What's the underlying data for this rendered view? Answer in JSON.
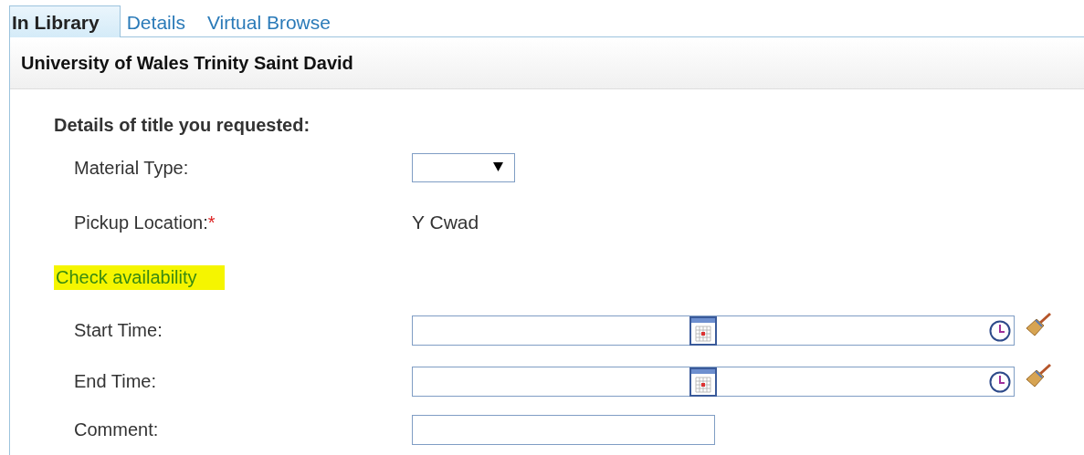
{
  "tabs": [
    {
      "label": "In Library",
      "selected": true
    },
    {
      "label": "Details",
      "selected": false
    },
    {
      "label": "Virtual Browse",
      "selected": false
    }
  ],
  "panel": {
    "title": "University of Wales Trinity Saint David",
    "section_heading": "Details of title you requested:",
    "fields": [
      {
        "kind": "select",
        "label": "Material Type:"
      },
      {
        "kind": "text_value",
        "label": "Pickup Location:",
        "required_mark": "*",
        "value": "Y Cwad"
      }
    ],
    "availability_link": {
      "label": "Check availability",
      "highlighted": true
    },
    "time_fields": [
      {
        "kind": "datetime",
        "label": "Start Time:"
      },
      {
        "kind": "datetime",
        "label": "End Time:"
      },
      {
        "kind": "text",
        "label": "Comment:"
      }
    ]
  }
}
